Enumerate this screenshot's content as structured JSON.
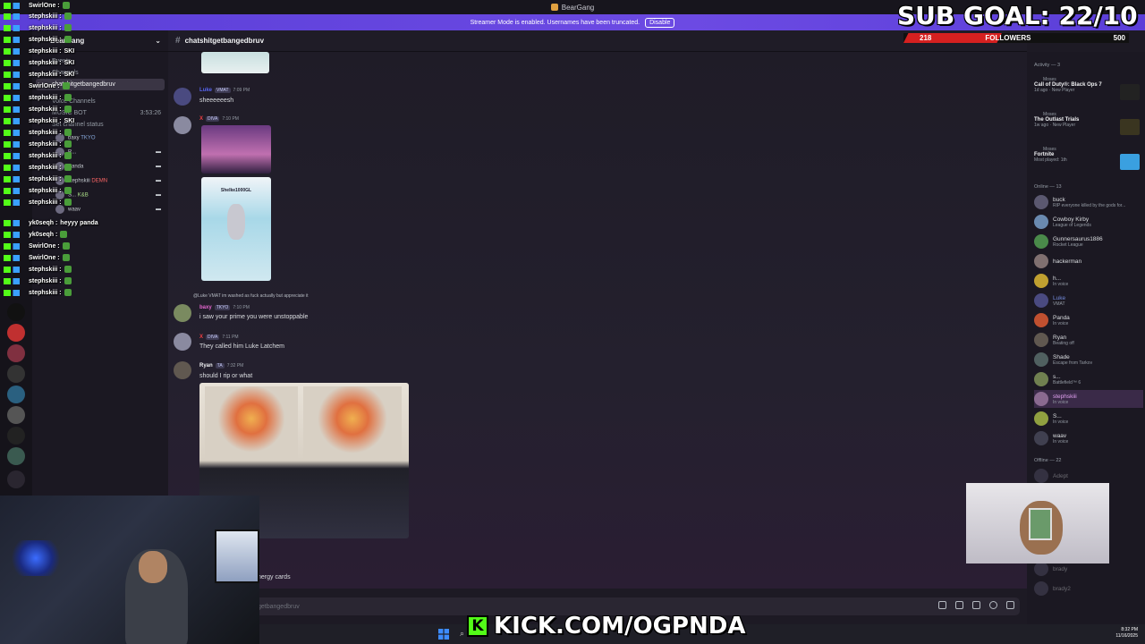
{
  "window": {
    "title": "BearGang"
  },
  "banner": {
    "text": "Streamer Mode is enabled. Usernames have been truncated.",
    "button": "Disable"
  },
  "server": {
    "name": "BearGang",
    "chevron": "⌄"
  },
  "channels": [
    {
      "label": "Events"
    },
    {
      "label": "Channels"
    },
    {
      "label": "chatshitgetbangedbruv",
      "active": true
    },
    {
      "label": "Voice Channels"
    },
    {
      "label": "MUSIC BOT"
    }
  ],
  "voice": {
    "status": "Set channel status",
    "timer": "3:53:26",
    "users": [
      {
        "name": "baxy",
        "tag": "TKYO"
      },
      {
        "name": "R..."
      },
      {
        "name": "Panda"
      },
      {
        "name": "stephskiii",
        "tag": "DEMN"
      },
      {
        "name": "S...",
        "tag": "K&B"
      },
      {
        "name": "waav"
      }
    ]
  },
  "kick_chat": [
    {
      "user": "SwirlOne :"
    },
    {
      "user": "stephskiii :"
    },
    {
      "user": "stephskiii :"
    },
    {
      "user": "stephskiii :"
    },
    {
      "user": "stephskiii :",
      "text": "SKI"
    },
    {
      "user": "stephskiii :",
      "text": "SKI"
    },
    {
      "user": "stephskiii :",
      "text": "SKI"
    },
    {
      "user": "SwirlOne :"
    },
    {
      "user": "stephskiii :"
    },
    {
      "user": "stephskiii :"
    },
    {
      "user": "stephskiii :",
      "text": "SKI"
    },
    {
      "user": "stephskiii :"
    },
    {
      "user": "stephskiii :"
    },
    {
      "user": "stephskiii :"
    },
    {
      "user": "stephskiii :"
    },
    {
      "user": "stephskiii :"
    },
    {
      "user": "stephskiii :"
    },
    {
      "user": "stephskiii :"
    },
    {
      "user": "yk0seqh :",
      "text": "heyyy panda"
    },
    {
      "user": "yk0seqh :"
    },
    {
      "user": "SwirlOne :"
    },
    {
      "user": "SwirlOne :"
    },
    {
      "user": "stephskiii :"
    },
    {
      "user": "stephskiii :"
    },
    {
      "user": "stephskiii :"
    }
  ],
  "chat": {
    "channel": "chatshitgetbangedbruv",
    "messages": [
      {
        "user": "Luke",
        "tag": "VMAT",
        "time": "7:09 PM",
        "text": "sheeeeeesh",
        "color": "#5865f2"
      },
      {
        "user": "X",
        "tag": "DIVA",
        "time": "7:10 PM",
        "text": "",
        "color": "#f23f43",
        "image_caption": "Shelke1000GL"
      },
      {
        "reply": "@Luke VMAT im washed as fuck actually but appreciate it",
        "user": "baxy",
        "tag": "TKYO",
        "time": "7:10 PM",
        "text": "i saw your prime you were unstoppable",
        "color": "#e667d0"
      },
      {
        "user": "X",
        "tag": "DIVA",
        "time": "7:11 PM",
        "text": "They called him Luke Latchem",
        "color": "#f23f43"
      },
      {
        "user": "Ryan",
        "tag": "TA",
        "time": "7:32 PM",
        "text": "should I rip or what",
        "color": "#f2f3f5"
      }
    ],
    "partial_text": "nergy cards",
    "composer_placeholder": "Message #chatshitgetbangedbruv",
    "composer_visible": "getbangedbruv"
  },
  "members": {
    "activity_title": "Activity — 3",
    "activity": [
      {
        "who": "Moses",
        "game": "Call of Duty®: Black Ops 7",
        "sub": "1d ago · New Player"
      },
      {
        "who": "Moses",
        "game": "The Outlast Trials",
        "sub": "1w ago · New Player"
      },
      {
        "who": "Moses",
        "game": "Fortnite",
        "sub": "Most played: 1th"
      }
    ],
    "online_title": "Online — 13",
    "online": [
      {
        "name": "buck",
        "status": "RIP everyone killed by the gods for..."
      },
      {
        "name": "Cowboy Kirby",
        "status": "League of Legends"
      },
      {
        "name": "Gunnersaurus1886",
        "status": "Rocket League"
      },
      {
        "name": "hackerman",
        "status": ""
      },
      {
        "name": "h...",
        "status": "In voice"
      },
      {
        "name": "Luke",
        "status": "",
        "tag": "VMAT"
      },
      {
        "name": "Panda",
        "status": "In voice"
      },
      {
        "name": "Ryan",
        "status": "Beating off",
        "tag": "TA"
      },
      {
        "name": "Shade",
        "status": "Escape from Tarkov",
        "tag": "HIDE"
      },
      {
        "name": "s...",
        "status": "Battlefield™ 6"
      },
      {
        "name": "stephskiii",
        "status": "In voice",
        "tag": "DEMN"
      },
      {
        "name": "S...",
        "status": "In voice",
        "tag": "K&B"
      },
      {
        "name": "waav",
        "status": "In voice"
      }
    ],
    "offline_title": "Offline — 22",
    "offline": [
      {
        "name": "Adept"
      },
      {
        "name": "brady"
      },
      {
        "name": "brady2"
      }
    ]
  },
  "overlay": {
    "sub_goal": "SUB GOAL: 22/10",
    "followers_current": "218",
    "followers_label": "FOLLOWERS",
    "followers_goal": "500",
    "followers_progress": 0.436,
    "kick_url": "KICK.COM/OGPNDA"
  },
  "taskbar": {
    "time": "8:32 PM",
    "date": "11/16/2025"
  },
  "colors": {
    "accent": "#5865f2",
    "kick_green": "#53fc18",
    "banner": "#6c4ae3",
    "follow_bar": "#d62020"
  }
}
